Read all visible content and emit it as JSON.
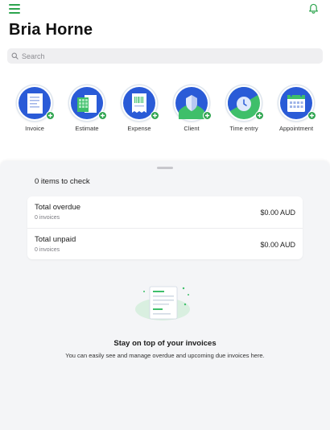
{
  "header": {
    "title": "Bria Horne",
    "menu_icon": "hamburger-menu-icon",
    "notification_icon": "bell-icon",
    "accent_color": "#2da44e"
  },
  "search": {
    "placeholder": "Search"
  },
  "quick_actions": [
    {
      "label": "Invoice",
      "icon": "invoice-icon"
    },
    {
      "label": "Estimate",
      "icon": "estimate-icon"
    },
    {
      "label": "Expense",
      "icon": "expense-receipt-icon"
    },
    {
      "label": "Client",
      "icon": "client-icon"
    },
    {
      "label": "Time entry",
      "icon": "clock-icon"
    },
    {
      "label": "Appointment",
      "icon": "calendar-icon"
    }
  ],
  "check_panel": {
    "summary": "0 items to check",
    "rows": [
      {
        "title": "Total overdue",
        "count": "0 invoices",
        "amount": "$0.00 AUD"
      },
      {
        "title": "Total unpaid",
        "count": "0 invoices",
        "amount": "$0.00 AUD"
      }
    ],
    "empty_state": {
      "title": "Stay on top of your invoices",
      "body": "You can easily see and manage overdue and upcoming due invoices here."
    }
  }
}
